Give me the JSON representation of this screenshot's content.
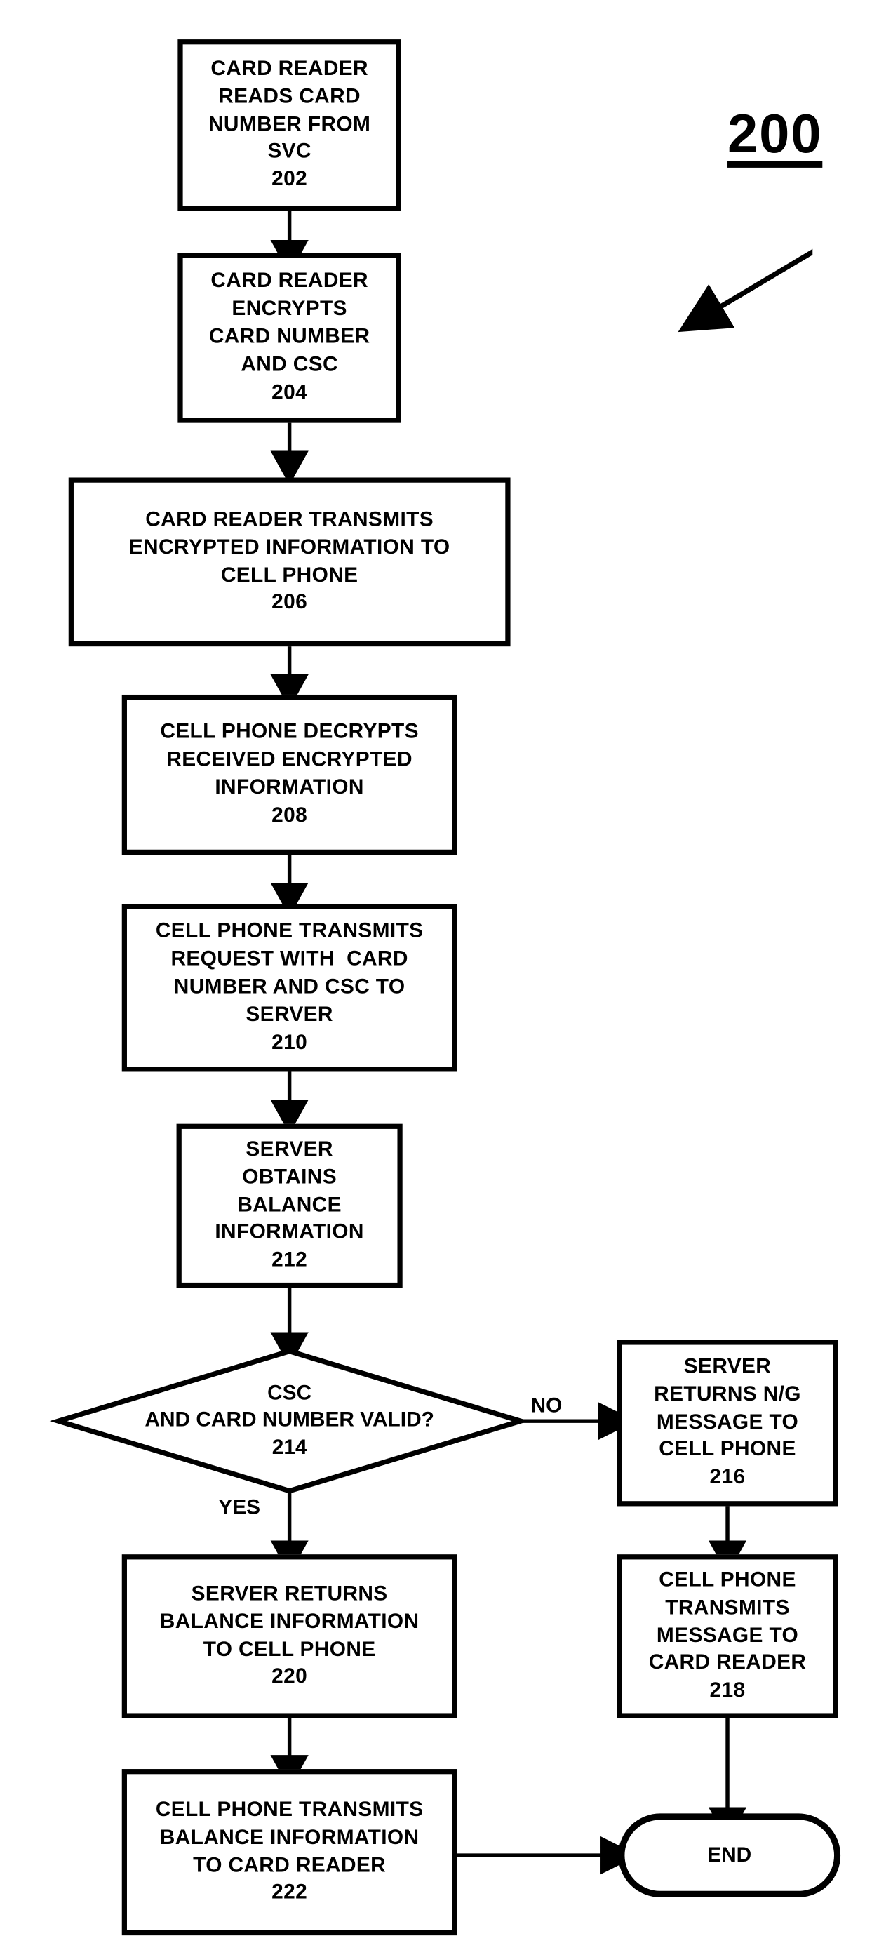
{
  "figure": {
    "number_label": "200",
    "pointer_icon": "diagonal-arrow"
  },
  "nodes": [
    {
      "id": "202",
      "shape": "process",
      "lines": [
        "CARD READER",
        "READS CARD",
        "NUMBER FROM",
        "SVC",
        "202"
      ]
    },
    {
      "id": "204",
      "shape": "process",
      "lines": [
        "CARD READER",
        "ENCRYPTS",
        "CARD NUMBER",
        "AND CSC",
        "204"
      ]
    },
    {
      "id": "206",
      "shape": "process",
      "lines": [
        "CARD READER TRANSMITS",
        "ENCRYPTED INFORMATION TO",
        "CELL PHONE",
        "206"
      ]
    },
    {
      "id": "208",
      "shape": "process",
      "lines": [
        "CELL PHONE DECRYPTS",
        "RECEIVED ENCRYPTED",
        "INFORMATION",
        "208"
      ]
    },
    {
      "id": "210",
      "shape": "process",
      "lines": [
        "CELL PHONE TRANSMITS",
        "REQUEST WITH  CARD",
        "NUMBER AND CSC TO",
        "SERVER",
        "210"
      ]
    },
    {
      "id": "212",
      "shape": "process",
      "lines": [
        "SERVER",
        "OBTAINS",
        "BALANCE",
        "INFORMATION",
        "212"
      ]
    },
    {
      "id": "214",
      "shape": "decision",
      "lines": [
        "CSC",
        "AND CARD NUMBER VALID?",
        "214"
      ]
    },
    {
      "id": "216",
      "shape": "process",
      "lines": [
        "SERVER",
        "RETURNS N/G",
        "MESSAGE TO",
        "CELL PHONE",
        "216"
      ]
    },
    {
      "id": "218",
      "shape": "process",
      "lines": [
        "CELL PHONE",
        "TRANSMITS",
        "MESSAGE TO",
        "CARD READER",
        "218"
      ]
    },
    {
      "id": "220",
      "shape": "process",
      "lines": [
        "SERVER RETURNS",
        "BALANCE INFORMATION",
        "TO CELL PHONE",
        "220"
      ]
    },
    {
      "id": "222",
      "shape": "process",
      "lines": [
        "CELL PHONE TRANSMITS",
        "BALANCE INFORMATION",
        "TO CARD READER",
        "222"
      ]
    },
    {
      "id": "end",
      "shape": "terminator",
      "lines": [
        "END"
      ]
    }
  ],
  "edge_labels": {
    "no": "NO",
    "yes": "YES"
  },
  "colors": {
    "stroke": "#000000",
    "fill": "#ffffff",
    "text": "#000000"
  }
}
